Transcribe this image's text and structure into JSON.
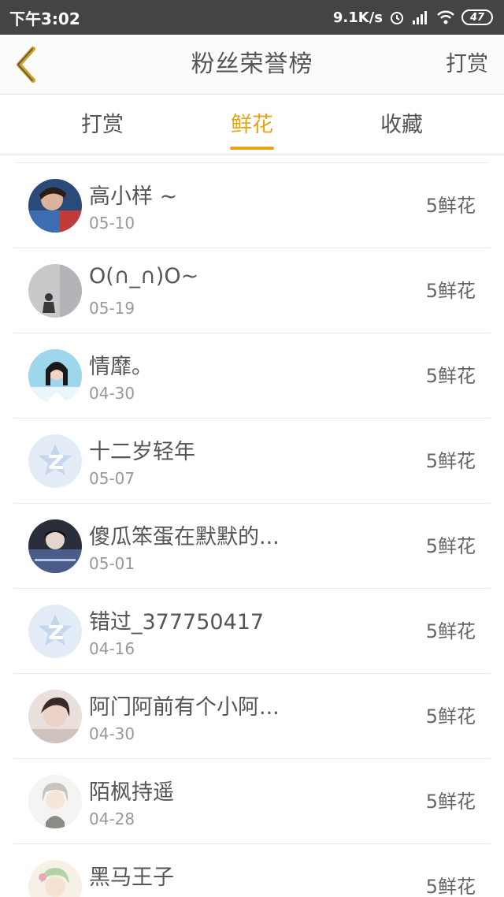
{
  "status_bar": {
    "time": "下午3:02",
    "net_speed": "9.1K/s",
    "battery": "47"
  },
  "header": {
    "title": "粉丝荣誉榜",
    "action_label": "打赏"
  },
  "tabs": [
    {
      "label": "打赏",
      "active": false
    },
    {
      "label": "鲜花",
      "active": true
    },
    {
      "label": "收藏",
      "active": false
    }
  ],
  "colors": {
    "accent": "#e8a31d",
    "status_bar": "#444444"
  },
  "fans": [
    {
      "name": "高小样 ~",
      "date": "05-10",
      "amount": "5鲜花",
      "avatar": "photo-boy"
    },
    {
      "name": "O(∩_∩)O~",
      "date": "05-19",
      "amount": "5鲜花",
      "avatar": "photo-gray"
    },
    {
      "name": "情靡。",
      "date": "04-30",
      "amount": "5鲜花",
      "avatar": "photo-girl"
    },
    {
      "name": "十二岁轻年",
      "date": "05-07",
      "amount": "5鲜花",
      "avatar": "default-z"
    },
    {
      "name": "傻瓜笨蛋在默默的...",
      "date": "05-01",
      "amount": "5鲜花",
      "avatar": "photo-dark"
    },
    {
      "name": "错过_377750417",
      "date": "04-16",
      "amount": "5鲜花",
      "avatar": "default-z"
    },
    {
      "name": "阿门阿前有个小阿...",
      "date": "04-30",
      "amount": "5鲜花",
      "avatar": "photo-boy2"
    },
    {
      "name": "陌枫持遥",
      "date": "04-28",
      "amount": "5鲜花",
      "avatar": "anime"
    },
    {
      "name": "黑马王子",
      "date": "",
      "amount": "5鲜花",
      "avatar": "anime2"
    }
  ]
}
